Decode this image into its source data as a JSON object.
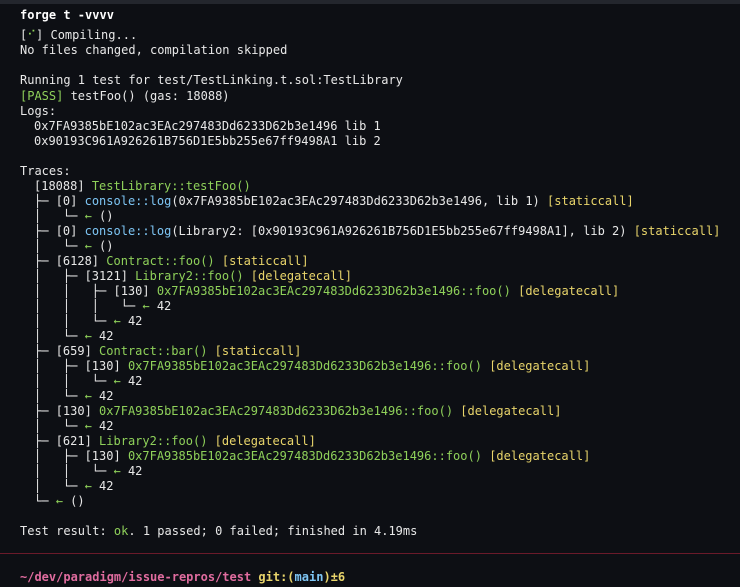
{
  "command": "forge t -vvvv",
  "compile": {
    "status_prefix": "[",
    "status_icon": "⠊",
    "status_suffix": "] Compiling...",
    "message": "No files changed, compilation skipped"
  },
  "run_header": "Running 1 test for test/TestLinking.t.sol:TestLibrary",
  "pass": {
    "tag": "[PASS]",
    "rest": " testFoo() (gas: 18088)"
  },
  "logs": {
    "label": "Logs:",
    "lines": [
      "0x7FA9385bE102ac3EAc297483Dd6233D62b3e1496 lib 1",
      "0x90193C961A926261B756D1E5bb255e67ff9498A1 lib 2"
    ]
  },
  "traces_label": "Traces:",
  "trace": {
    "root_gas": "[18088]",
    "root_call": "TestLibrary::testFoo()",
    "c1_tree": "├─ ",
    "c1_gas": "[0]",
    "c1_name": "console::log",
    "c1_args": "(0x7FA9385bE102ac3EAc297483Dd6233D62b3e1496, lib 1)",
    "c1_kind": "[staticcall]",
    "r1_tree": "│   └─ ",
    "r1_val": "()",
    "c2_tree": "├─ ",
    "c2_gas": "[0]",
    "c2_name": "console::log",
    "c2_args": "(Library2: [0x90193C961A926261B756D1E5bb255e67ff9498A1], lib 2)",
    "c2_kind": "[staticcall]",
    "r2_tree": "│   └─ ",
    "r2_val": "()",
    "c3_tree": "├─ ",
    "c3_gas": "[6128]",
    "c3_name": "Contract::foo()",
    "c3_kind": "[staticcall]",
    "c3a_tree": "│   ├─ ",
    "c3a_gas": "[3121]",
    "c3a_name": "Library2::foo()",
    "c3a_kind": "[delegatecall]",
    "c3b_tree": "│   │   ├─ ",
    "c3b_gas": "[130]",
    "c3b_name": "0x7FA9385bE102ac3EAc297483Dd6233D62b3e1496::foo()",
    "c3b_kind": "[delegatecall]",
    "r3b_tree": "│   │   │   └─ ",
    "r3b_val": "42",
    "r3a_tree": "│   │   └─ ",
    "r3a_val": "42",
    "r3_tree": "│   └─ ",
    "r3_val": "42",
    "c4_tree": "├─ ",
    "c4_gas": "[659]",
    "c4_name": "Contract::bar()",
    "c4_kind": "[staticcall]",
    "c4a_tree": "│   ├─ ",
    "c4a_gas": "[130]",
    "c4a_name": "0x7FA9385bE102ac3EAc297483Dd6233D62b3e1496::foo()",
    "c4a_kind": "[delegatecall]",
    "r4a_tree": "│   │   └─ ",
    "r4a_val": "42",
    "r4_tree": "│   └─ ",
    "r4_val": "42",
    "c5_tree": "├─ ",
    "c5_gas": "[130]",
    "c5_name": "0x7FA9385bE102ac3EAc297483Dd6233D62b3e1496::foo()",
    "c5_kind": "[delegatecall]",
    "r5_tree": "│   └─ ",
    "r5_val": "42",
    "c6_tree": "├─ ",
    "c6_gas": "[621]",
    "c6_name": "Library2::foo()",
    "c6_kind": "[delegatecall]",
    "c6a_tree": "│   ├─ ",
    "c6a_gas": "[130]",
    "c6a_name": "0x7FA9385bE102ac3EAc297483Dd6233D62b3e1496::foo()",
    "c6a_kind": "[delegatecall]",
    "r6a_tree": "│   │   └─ ",
    "r6a_val": "42",
    "r6_tree": "│   └─ ",
    "r6_val": "42",
    "rend_tree": "└─ ",
    "rend_val": "()"
  },
  "return_arrow": "← ",
  "result": {
    "prefix": "Test result: ",
    "ok": "ok",
    "rest": ". 1 passed; 0 failed; finished in 4.19ms"
  },
  "prompt": {
    "path": "~/dev/paradigm/issue-repros/test",
    "git_open": " git:(",
    "branch": "main",
    "git_close": ")",
    "dirty": "±6"
  },
  "colors": {
    "background": "#0d0f14",
    "pass_green": "#8fd15a",
    "call_cyan": "#7ec6f5",
    "call_yellow": "#e9d56b",
    "prompt_pink": "#e06c9f"
  }
}
